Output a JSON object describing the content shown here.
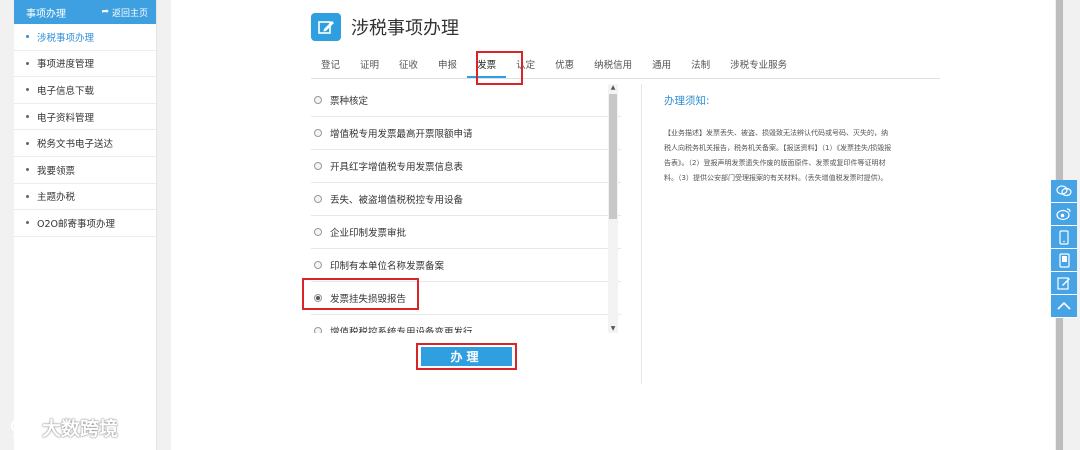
{
  "sidebar": {
    "header_title": "事项办理",
    "back_label": "返回主页",
    "items": [
      {
        "label": "涉税事项办理"
      },
      {
        "label": "事项进度管理"
      },
      {
        "label": "电子信息下载"
      },
      {
        "label": "电子资料管理"
      },
      {
        "label": "税务文书电子送达"
      },
      {
        "label": "我要领票"
      },
      {
        "label": "主题办税"
      },
      {
        "label": "O2O邮寄事项办理"
      }
    ],
    "active_index": 0
  },
  "main": {
    "title": "涉税事项办理",
    "tabs": [
      "登记",
      "证明",
      "征收",
      "申报",
      "发票",
      "认定",
      "优惠",
      "纳税信用",
      "通用",
      "法制",
      "涉税专业服务"
    ],
    "active_tab": "发票",
    "list": [
      {
        "label": "票种核定",
        "selected": false
      },
      {
        "label": "增值税专用发票最高开票限额申请",
        "selected": false
      },
      {
        "label": "开具红字增值税专用发票信息表",
        "selected": false
      },
      {
        "label": "丢失、被盗增值税税控专用设备",
        "selected": false
      },
      {
        "label": "企业印制发票审批",
        "selected": false
      },
      {
        "label": "印制有本单位名称发票备案",
        "selected": false
      },
      {
        "label": "发票挂失损毁报告",
        "selected": true
      },
      {
        "label": "增值税税控系统专用设备变更发行",
        "selected": false
      }
    ],
    "action_button": "办理",
    "notice": {
      "title": "办理须知:",
      "body": "【业务描述】发票丢失、被盗、损毁致无法辨认代码或号码、灭失的，纳税人向税务机关报告，税务机关备案。【报送资料】（1）《发票挂失/损毁报告表》。（2）登报声明发票遗失作废的版面原件、发票或复印件等证明材料。（3）提供公安部门受理报案的有关材料。(丢失增值税发票时提供)。"
    }
  },
  "watermark": "大数跨境",
  "float_tools": [
    "chat-icon",
    "weibo-icon",
    "mobile-icon",
    "tablet-icon",
    "edit-icon",
    "back-to-top-icon"
  ],
  "colors": {
    "accent": "#2f9fe0",
    "highlight": "#d9252a",
    "sidebar_header": "#3ea0e0"
  }
}
